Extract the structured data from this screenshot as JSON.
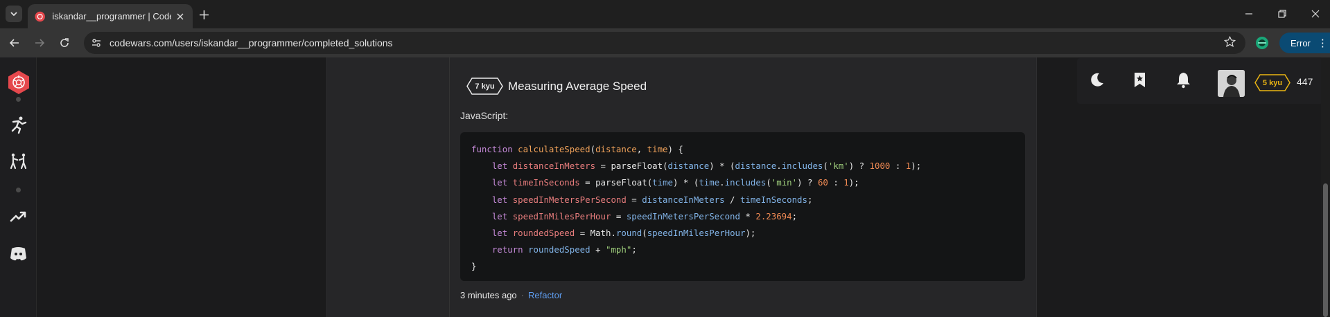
{
  "browser": {
    "tab_title": "iskandar__programmer | Codewars",
    "url": "codewars.com/users/iskandar__programmer/completed_solutions",
    "error_label": "Error",
    "icons": {
      "tab_search": "chevron-down-icon",
      "close": "close-icon",
      "new_tab": "plus-icon",
      "back": "arrow-left-icon",
      "forward": "arrow-right-icon",
      "reload": "reload-icon",
      "site_info": "tune-icon",
      "bookmark": "star-icon",
      "minimize": "minimize-icon",
      "restore": "restore-icon",
      "window_close": "close-icon"
    }
  },
  "kata": {
    "rank": "7 kyu",
    "title": "Measuring Average Speed",
    "language": "JavaScript:",
    "code_lines": [
      "function calculateSpeed(distance, time) {",
      "    let distanceInMeters = parseFloat(distance) * (distance.includes('km') ? 1000 : 1);",
      "    let timeInSeconds = parseFloat(time) * (time.includes('min') ? 60 : 1);",
      "    let speedInMetersPerSecond = distanceInMeters / timeInSeconds;",
      "    let speedInMilesPerHour = speedInMetersPerSecond * 2.23694;",
      "    let roundedSpeed = Math.round(speedInMilesPerHour);",
      "    return roundedSpeed + \"mph\";",
      "}"
    ],
    "time_ago": "3 minutes ago",
    "separator": "·",
    "refactor_label": "Refactor"
  },
  "user": {
    "rank": "5 kyu",
    "honor": "447"
  },
  "colors": {
    "brand": "#e5484d",
    "rank_yellow": "#ecb613",
    "link": "#5e9df0",
    "error_pill": "#0a4a73"
  }
}
